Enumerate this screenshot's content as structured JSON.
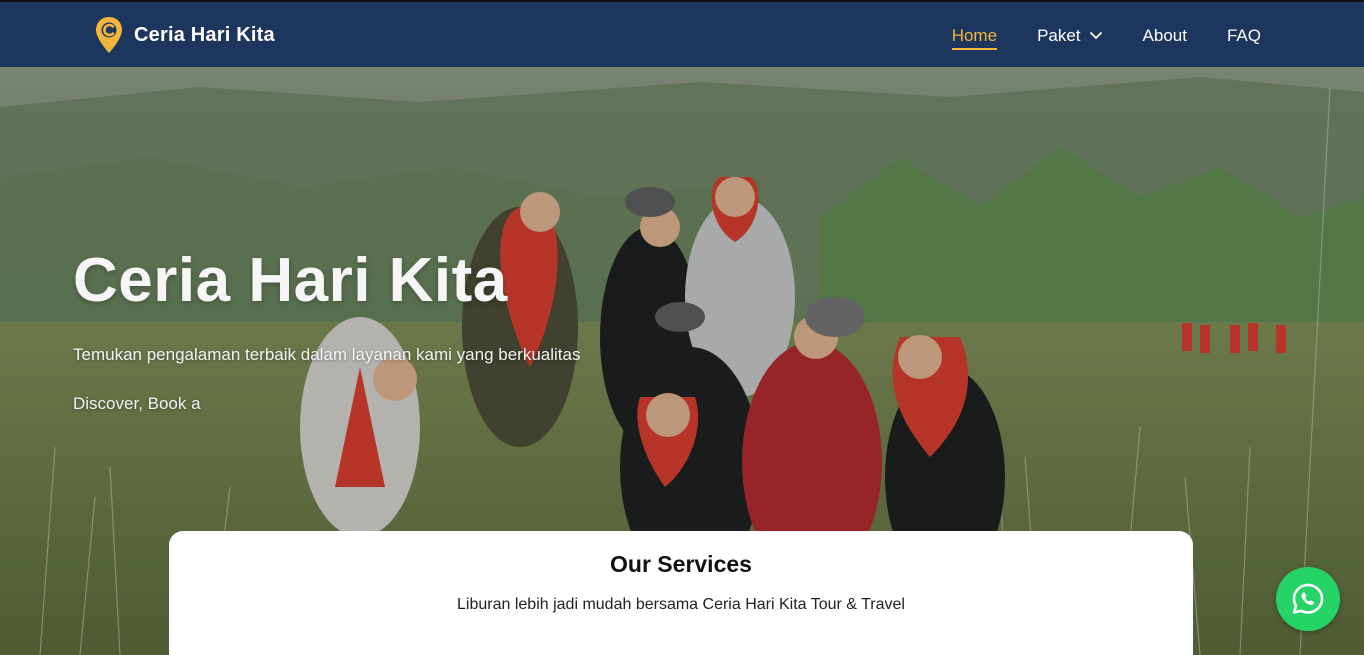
{
  "brand": {
    "name": "Ceria Hari Kita",
    "logo_icon": "location-pin-logo-icon",
    "accent_color": "#f2b63c",
    "navbar_color": "#1d365e"
  },
  "nav": {
    "items": [
      {
        "label": "Home",
        "active": true
      },
      {
        "label": "Paket",
        "has_dropdown": true,
        "icon": "chevron-down-icon"
      },
      {
        "label": "About"
      },
      {
        "label": "FAQ"
      }
    ]
  },
  "hero": {
    "title": "Ceria Hari Kita",
    "subtitle": "Temukan pengalaman terbaik dalam layanan kami yang berkualitas",
    "typed_text": "Discover, Book a"
  },
  "services": {
    "title": "Our Services",
    "subtitle": "Liburan lebih jadi mudah bersama Ceria Hari Kita Tour & Travel"
  },
  "whatsapp": {
    "icon": "whatsapp-icon",
    "color": "#25d366"
  }
}
